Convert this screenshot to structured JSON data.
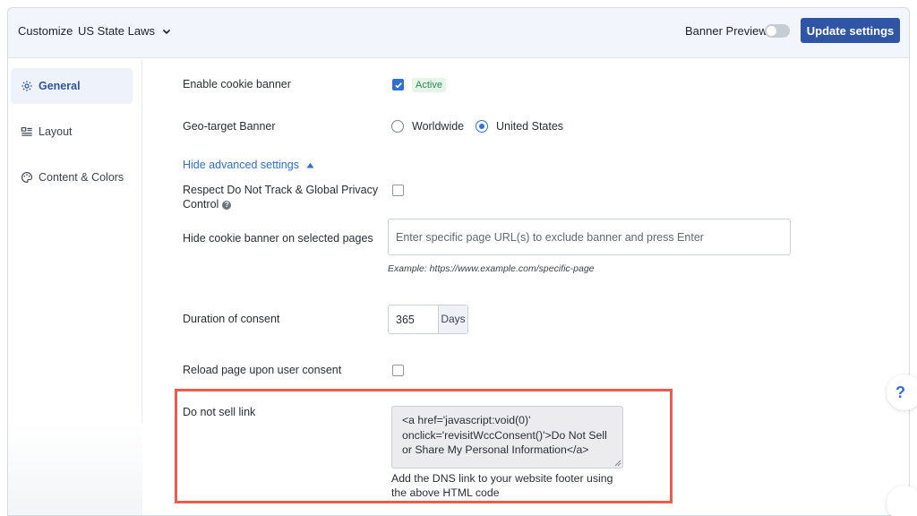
{
  "header": {
    "customize_label": "Customize",
    "law_select_value": "US State Laws",
    "preview_label": "Banner Preview",
    "update_button": "Update settings"
  },
  "sidebar": {
    "items": [
      {
        "label": "General",
        "icon": "gear-icon",
        "active": true
      },
      {
        "label": "Layout",
        "icon": "layout-icon",
        "active": false
      },
      {
        "label": "Content & Colors",
        "icon": "palette-icon",
        "active": false
      }
    ]
  },
  "settings": {
    "enable_banner": {
      "label": "Enable cookie banner",
      "status": "Active",
      "checked": true
    },
    "geo_target": {
      "label": "Geo-target Banner",
      "options": [
        "Worldwide",
        "United States"
      ],
      "selected": "United States"
    },
    "advanced_toggle": "Hide advanced settings",
    "dnt": {
      "label_line1": "Respect Do Not Track & Global Privacy",
      "label_line2": "Control",
      "checked": false
    },
    "hide_pages": {
      "label": "Hide cookie banner on selected pages",
      "placeholder": "Enter specific page URL(s) to exclude banner and press Enter",
      "example": "Example: https://www.example.com/specific-page"
    },
    "duration": {
      "label": "Duration of consent",
      "value": "365",
      "unit": "Days"
    },
    "reload": {
      "label": "Reload page upon user consent",
      "checked": false
    },
    "do_not_sell": {
      "label": "Do not sell link",
      "code_line1": "<a href='javascript:void(0)'",
      "code_line2": "onclick='revisitWccConsent()'>Do Not Sell",
      "code_line3": "or Share My Personal Information</a>",
      "help_line1": "Add the DNS link to your website footer using",
      "help_line2": "the above HTML code"
    }
  },
  "floating": {
    "help_symbol": "?"
  },
  "colors": {
    "accent": "#2f55a4",
    "link": "#2f6fd6",
    "highlight": "#ef5a4f",
    "badge_text": "#2d8a4e"
  }
}
